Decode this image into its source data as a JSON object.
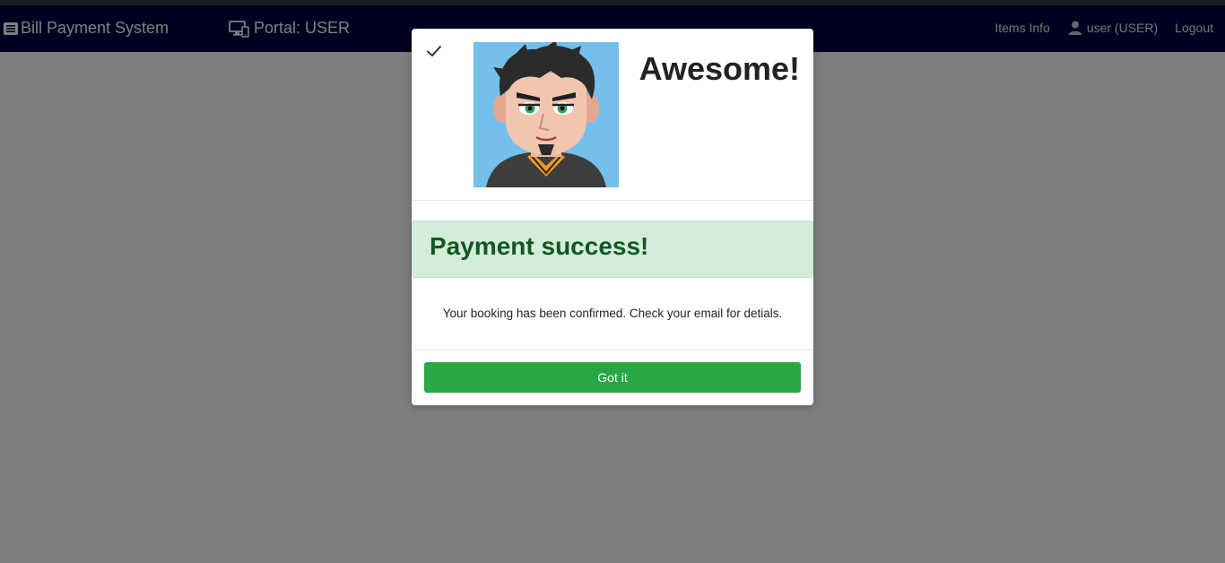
{
  "navbar": {
    "brand": "Bill Payment System",
    "brand_icon": "list-icon",
    "portal": "Portal: USER",
    "portal_icon": "devices-icon",
    "items_info": "Items Info",
    "user_icon": "user-icon",
    "user": "user (USER)",
    "logout": "Logout"
  },
  "modal": {
    "check_icon": "checkmark-icon",
    "avatar": "cartoon-man-avatar",
    "heading": "Awesome!",
    "alert": "Payment success!",
    "message": "Your booking has been confirmed. Check your email for detials.",
    "button": "Got it"
  },
  "colors": {
    "navbar_bg": "#000040",
    "alert_bg": "#d4edda",
    "alert_text": "#155724",
    "button_bg": "#28a745",
    "avatar_bg": "#74c0ea"
  }
}
